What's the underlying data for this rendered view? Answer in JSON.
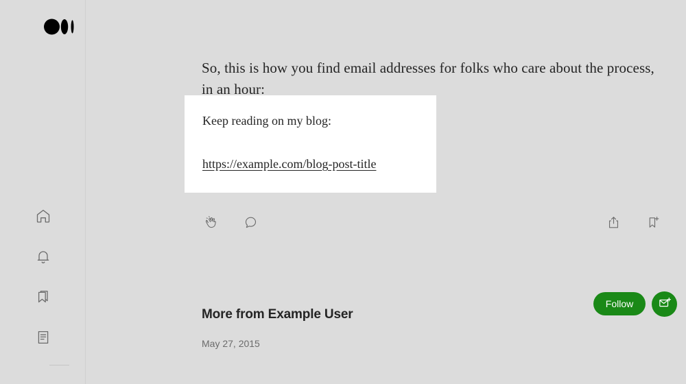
{
  "colors": {
    "page_background": "#dcdcdc",
    "card_background": "#ffffff",
    "text_primary": "#242424",
    "text_muted": "#6b6b6b",
    "brand_green": "#1a8917",
    "icon_stroke": "#6b6b6b"
  },
  "sidebar": {
    "logo_name": "medium-logo",
    "items": [
      {
        "name": "home",
        "icon": "home-icon"
      },
      {
        "name": "notifications",
        "icon": "bell-icon"
      },
      {
        "name": "bookmarks",
        "icon": "bookmark-stack-icon"
      },
      {
        "name": "stories",
        "icon": "document-lines-icon"
      }
    ]
  },
  "article": {
    "paragraph": "So, this is how you find email addresses for folks who care about the process, in an hour:",
    "embed": {
      "text": "Keep reading on my blog:",
      "link_label": "https://example.com/blog-post-title"
    }
  },
  "actions": {
    "left": [
      {
        "name": "clap-button",
        "icon": "clap-icon"
      },
      {
        "name": "comment-button",
        "icon": "comment-bubble-icon"
      }
    ],
    "right": [
      {
        "name": "share-button",
        "icon": "share-upload-icon"
      },
      {
        "name": "save-button",
        "icon": "bookmark-plus-icon"
      }
    ]
  },
  "more_from": {
    "heading": "More from Example User",
    "date": "May 27, 2015",
    "follow_label": "Follow",
    "subscribe_icon": "envelope-plus-icon"
  }
}
